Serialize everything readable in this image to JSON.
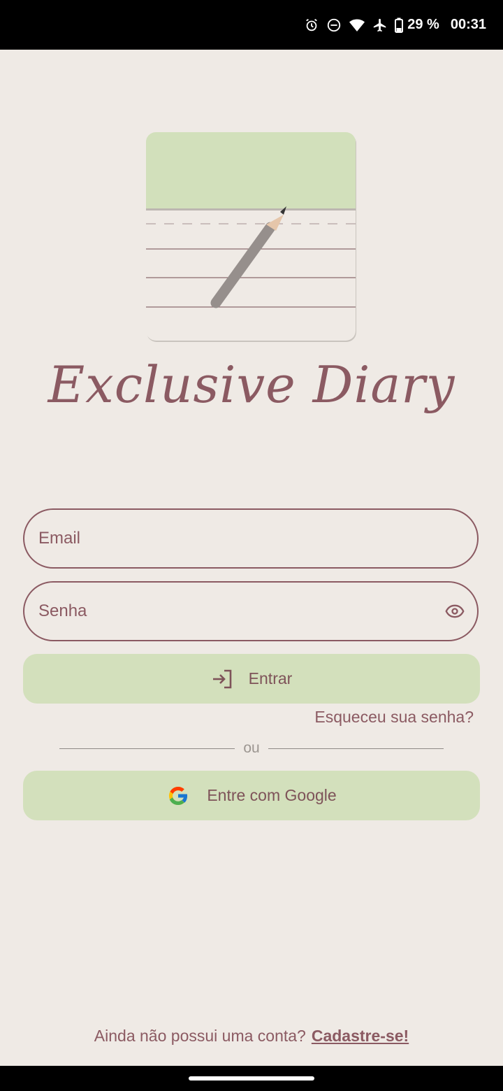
{
  "status_bar": {
    "battery": "29 %",
    "time": "00:31"
  },
  "app": {
    "title": "Exclusive Diary"
  },
  "form": {
    "email_placeholder": "Email",
    "password_placeholder": "Senha",
    "login_label": "Entrar",
    "forgot_label": "Esqueceu sua senha?",
    "divider_label": "ou",
    "google_label": "Entre com Google"
  },
  "footer": {
    "prompt": "Ainda não possui uma conta?",
    "signup_label": "Cadastre-se!"
  },
  "colors": {
    "background": "#EFEAE5",
    "accent": "#8B5A62",
    "button_bg": "#D3E0BC"
  }
}
